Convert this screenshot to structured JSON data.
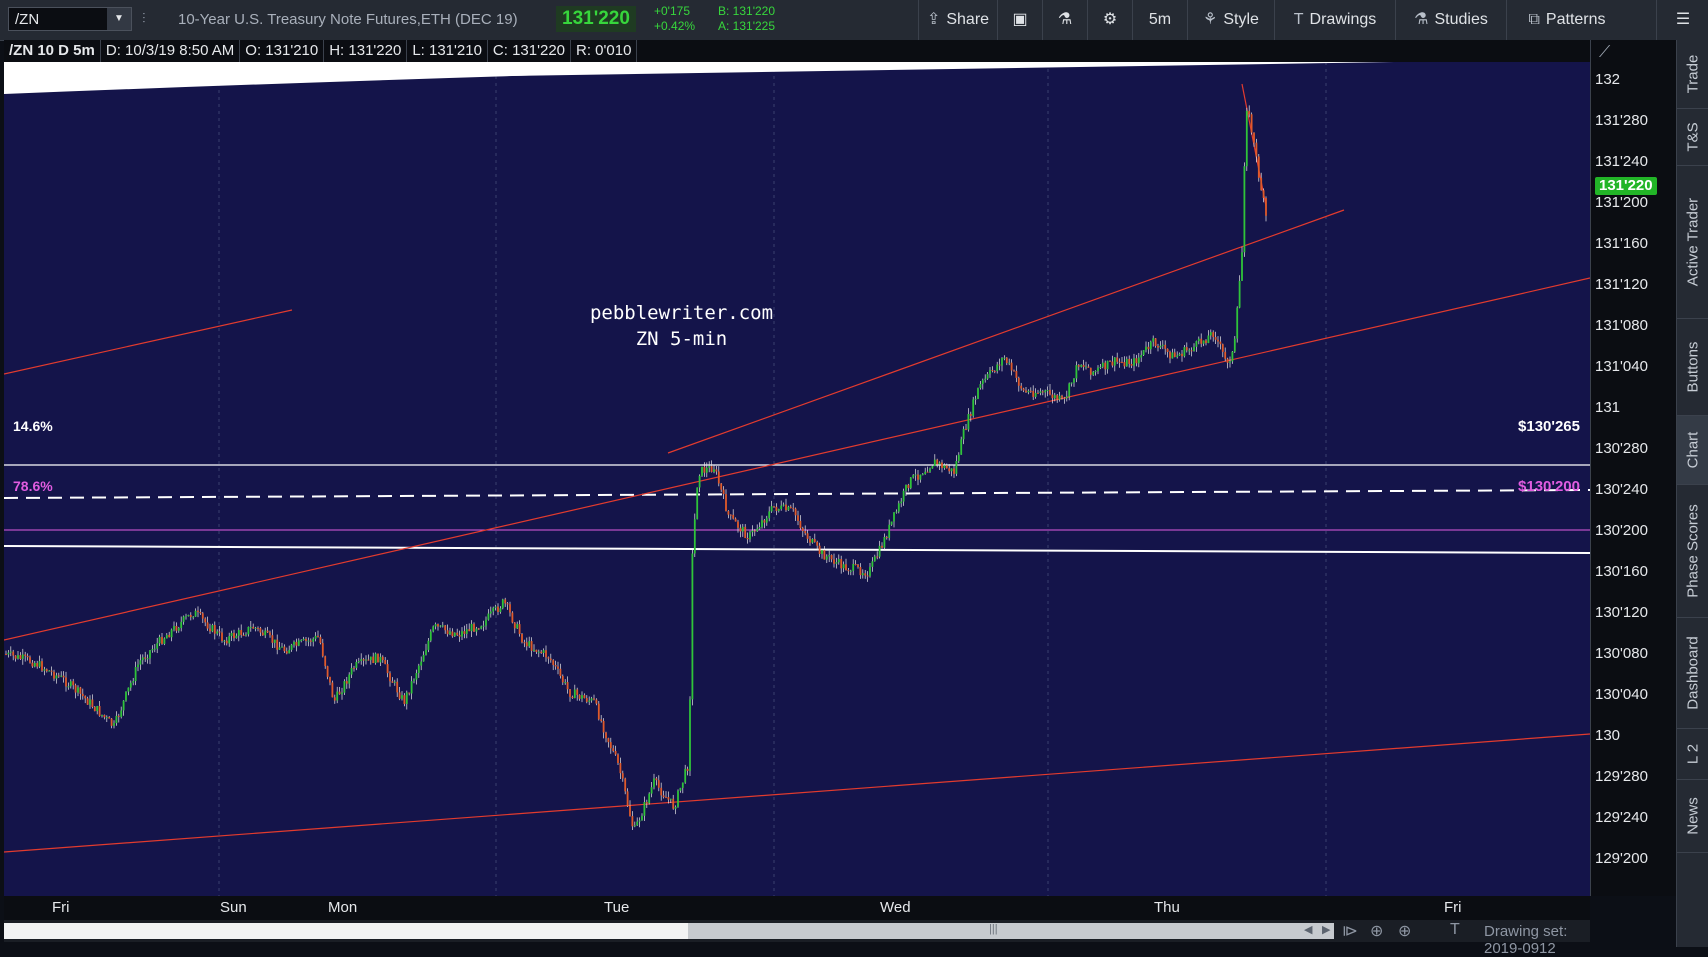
{
  "header": {
    "symbol": "/ZN",
    "description": "10-Year U.S. Treasury Note Futures,ETH (DEC 19)",
    "last_price": "131'220",
    "change": "+0'175",
    "change_pct": "+0.42%",
    "bid": "B: 131'220",
    "ask": "A: 131'225",
    "share_label": "Share",
    "timeframe_label": "5m",
    "style_label": "Style",
    "drawings_label": "Drawings",
    "studies_label": "Studies",
    "patterns_label": "Patterns"
  },
  "info_bar": {
    "symbol_period": "/ZN 10 D 5m",
    "date": "D: 10/3/19 8:50 AM",
    "open": "O: 131'210",
    "high": "H: 131'220",
    "low": "L: 131'210",
    "close": "C: 131'220",
    "range": "R: 0'010"
  },
  "chart_data": {
    "type": "candlestick",
    "watermark_line1": "pebblewriter.com",
    "watermark_line2": "ZN 5-min",
    "y_ticks": [
      "132",
      "131'280",
      "131'240",
      "131'200",
      "131'160",
      "131'120",
      "131'080",
      "131'040",
      "131",
      "130'280",
      "130'240",
      "130'200",
      "130'160",
      "130'120",
      "130'080",
      "130'040",
      "130",
      "129'280",
      "129'240",
      "129'200"
    ],
    "x_ticks": [
      "Fri",
      "Sun",
      "Mon",
      "Tue",
      "Wed",
      "Thu",
      "Fri"
    ],
    "current_price_label": "131'220",
    "levels": [
      {
        "pct_label": "14.6%",
        "price_label": "$130'265",
        "color": "#ffffff"
      },
      {
        "pct_label": "78.6%",
        "price_label": "$130'200",
        "color": "#e05ce0"
      }
    ],
    "up_color": "#2fc43a",
    "down_color": "#e05a2a",
    "trendline_color": "#e23b2e",
    "background_color": "#14144a"
  },
  "bottom_bar": {
    "drawing_set": "Drawing set: 2019-0912"
  },
  "right_rail": {
    "tabs": [
      "Trade",
      "T&S",
      "Active Trader",
      "Buttons",
      "Chart",
      "Phase Scores",
      "Dashboard",
      "L 2",
      "News"
    ],
    "active": "Chart"
  }
}
